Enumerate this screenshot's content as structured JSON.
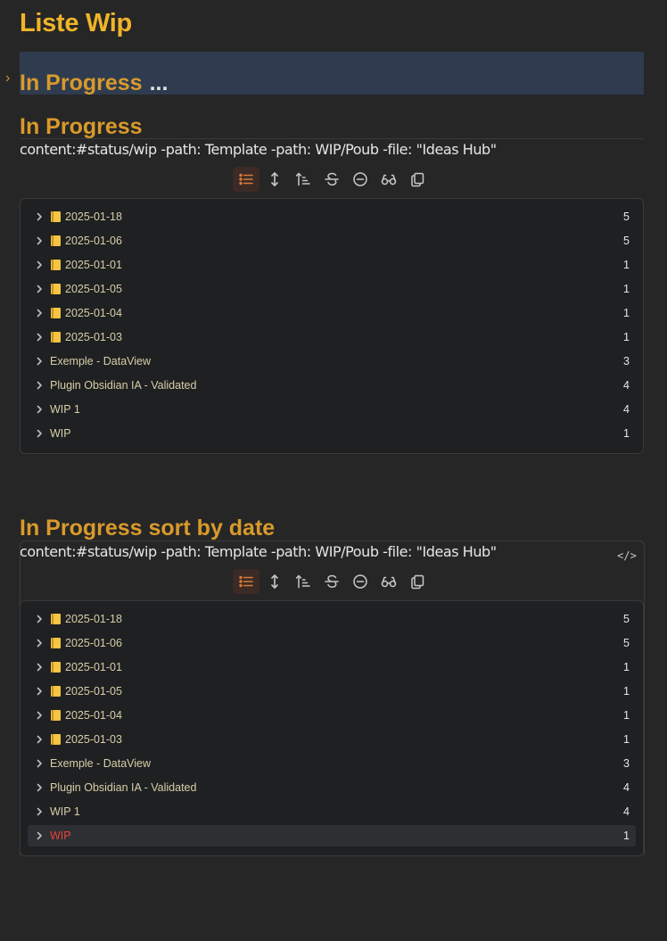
{
  "page": {
    "title": "Liste Wip"
  },
  "collapsed_section": {
    "title": "In Progress",
    "ellipsis": "..."
  },
  "sections": [
    {
      "title": "In Progress",
      "query": "content:#status/wip -path: Template -path: WIP/Poub -file: \"Ideas Hub\"",
      "results": [
        {
          "label": "2025-01-18",
          "count": "5",
          "icon": "notebook-icon"
        },
        {
          "label": "2025-01-06",
          "count": "5",
          "icon": "notebook-icon"
        },
        {
          "label": "2025-01-01",
          "count": "1",
          "icon": "notebook-icon"
        },
        {
          "label": "2025-01-05",
          "count": "1",
          "icon": "notebook-icon"
        },
        {
          "label": "2025-01-04",
          "count": "1",
          "icon": "notebook-icon"
        },
        {
          "label": "2025-01-03",
          "count": "1",
          "icon": "notebook-icon"
        },
        {
          "label": "Exemple - DataView",
          "count": "3"
        },
        {
          "label": "Plugin Obsidian IA - Validated",
          "count": "4"
        },
        {
          "label": "WIP 1",
          "count": "4"
        },
        {
          "label": "WIP",
          "count": "1"
        }
      ]
    },
    {
      "title": "In Progress sort by date",
      "query": "content:#status/wip -path: Template -path: WIP/Poub -file: \"Ideas Hub\"",
      "code_button": "</>",
      "results": [
        {
          "label": "2025-01-18",
          "count": "5",
          "icon": "notebook-icon"
        },
        {
          "label": "2025-01-06",
          "count": "5",
          "icon": "notebook-icon"
        },
        {
          "label": "2025-01-01",
          "count": "1",
          "icon": "notebook-icon"
        },
        {
          "label": "2025-01-05",
          "count": "1",
          "icon": "notebook-icon"
        },
        {
          "label": "2025-01-04",
          "count": "1",
          "icon": "notebook-icon"
        },
        {
          "label": "2025-01-03",
          "count": "1",
          "icon": "notebook-icon"
        },
        {
          "label": "Exemple - DataView",
          "count": "3"
        },
        {
          "label": "Plugin Obsidian IA - Validated",
          "count": "4"
        },
        {
          "label": "WIP 1",
          "count": "4"
        },
        {
          "label": "WIP",
          "count": "1",
          "highlighted": true
        }
      ]
    }
  ],
  "toolbar_buttons": [
    "list-icon",
    "expand-icon",
    "sort-icon",
    "strikethrough-icon",
    "collapse-icon",
    "glasses-icon",
    "copy-icon"
  ],
  "colors": {
    "title": "#f0b429",
    "heading": "#d99a2b",
    "accent": "#d97a3a",
    "highlight_text": "#e8453c",
    "background": "#262626",
    "panel": "#1f2022"
  }
}
